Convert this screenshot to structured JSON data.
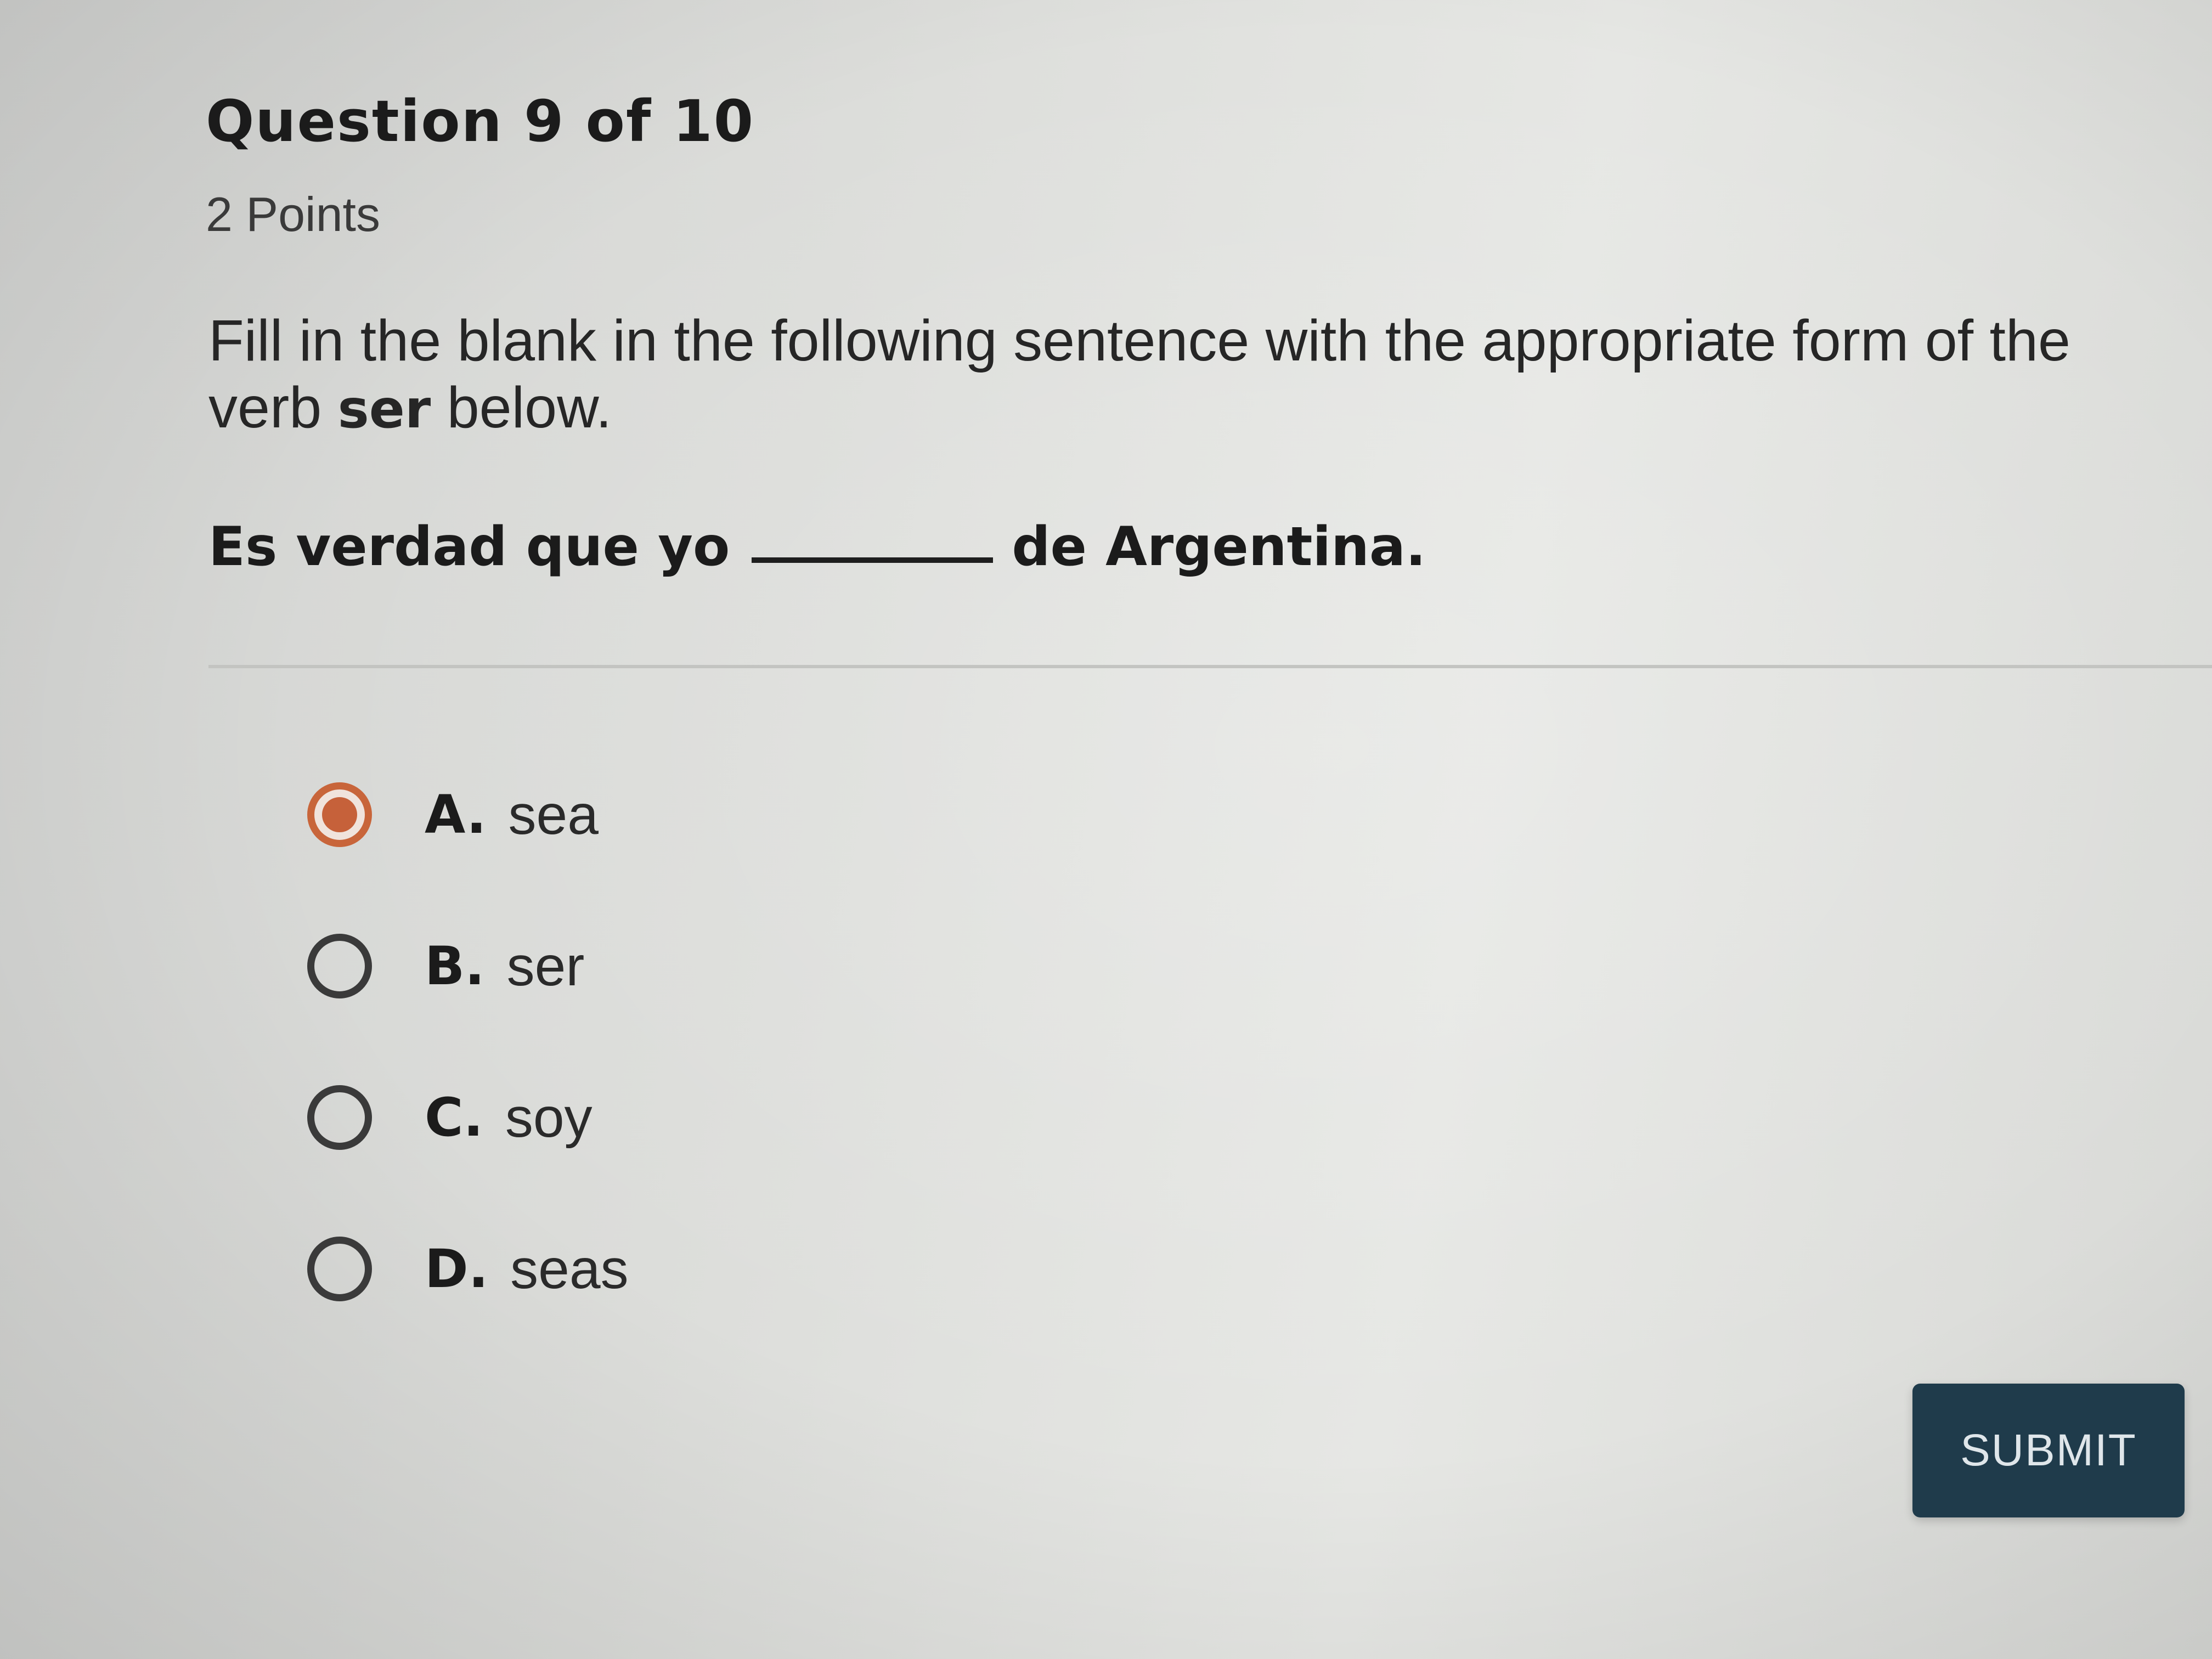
{
  "question": {
    "header": "Question 9 of 10",
    "points": "2 Points",
    "instruction_part1": "Fill in the blank in the following sentence with the appropriate form of the verb ",
    "instruction_bold": "ser",
    "instruction_part2": " below.",
    "sentence_before": "Es verdad que yo",
    "sentence_after": "de Argentina."
  },
  "options": [
    {
      "letter": "A.",
      "text": "sea",
      "selected": true
    },
    {
      "letter": "B.",
      "text": "ser",
      "selected": false
    },
    {
      "letter": "C.",
      "text": "soy",
      "selected": false
    },
    {
      "letter": "D.",
      "text": "seas",
      "selected": false
    }
  ],
  "submit": {
    "label": "SUBMIT"
  },
  "colors": {
    "selected_accent": "#c6613a",
    "submit_background": "#1f3b4b"
  }
}
